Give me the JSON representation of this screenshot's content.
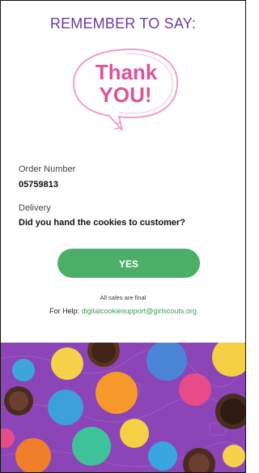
{
  "screen": {
    "heading": "REMEMBER TO SAY:",
    "bubble_text": "Thank YOU!",
    "bubble_line1": "Thank",
    "bubble_line2": "YOU!"
  },
  "order": {
    "label": "Order Number",
    "number": "05759813"
  },
  "delivery": {
    "label": "Delivery",
    "question": "Did you hand the cookies to customer?"
  },
  "actions": {
    "yes_label": "YES"
  },
  "footer": {
    "sales_note": "All sales are final",
    "help_prefix": "For Help: ",
    "help_email": "digitalcookiesupport@girlscouts.org"
  },
  "colors": {
    "heading": "#6b3aa0",
    "bubble_pink": "#e0529a",
    "button_green": "#4caf67",
    "link_green": "#3f9a52",
    "banner_purple": "#8b45b6"
  }
}
